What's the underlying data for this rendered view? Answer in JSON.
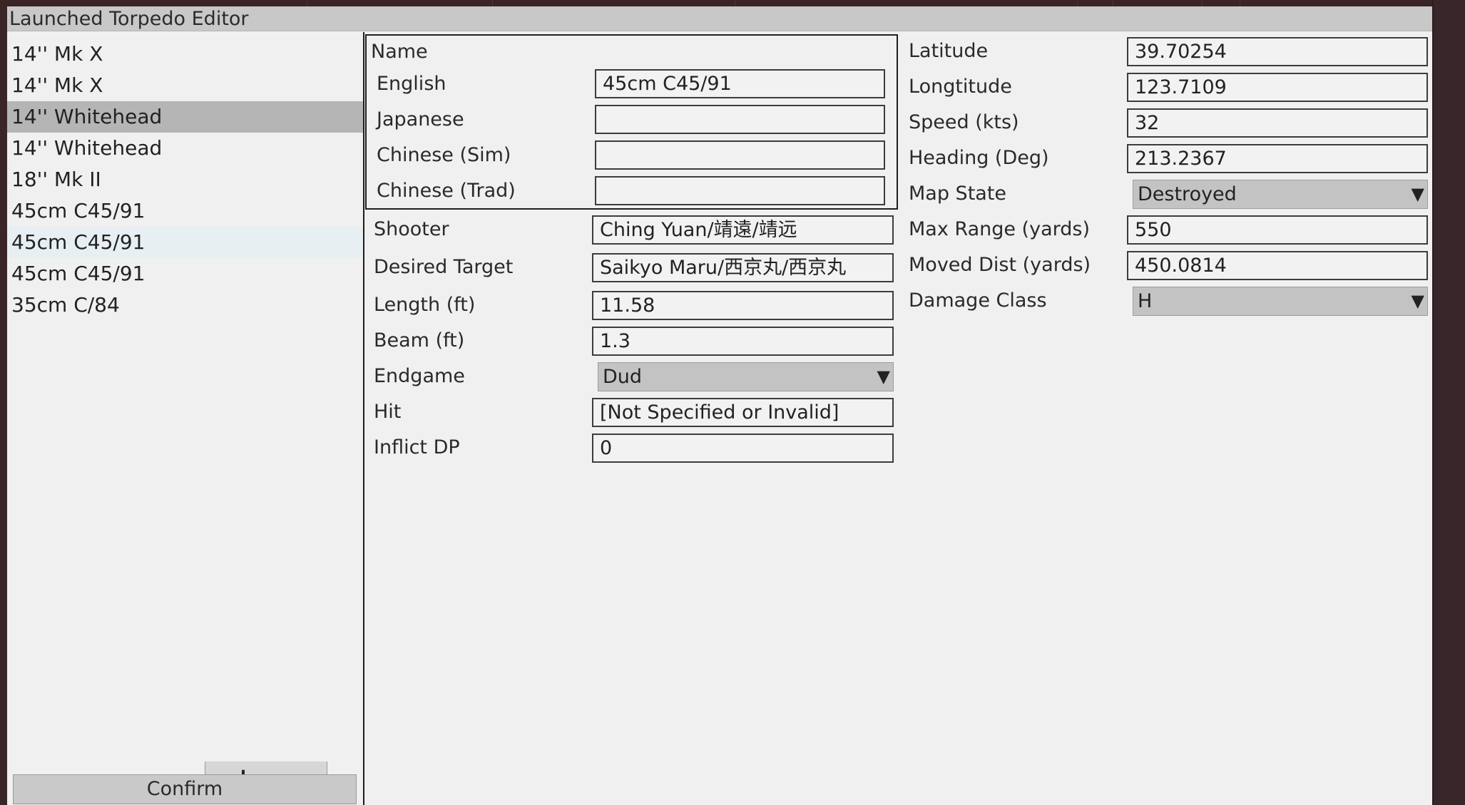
{
  "window": {
    "title": "Launched Torpedo Editor"
  },
  "torpedo_list": {
    "items": [
      {
        "label": "14'' Mk X"
      },
      {
        "label": "14'' Mk X"
      },
      {
        "label": "14'' Whitehead"
      },
      {
        "label": "14'' Whitehead"
      },
      {
        "label": "18'' Mk II"
      },
      {
        "label": "45cm C45/91"
      },
      {
        "label": "45cm C45/91"
      },
      {
        "label": "45cm C45/91"
      },
      {
        "label": "35cm C/84"
      }
    ],
    "selected_index": 2,
    "add_label": "+",
    "remove_label": "-",
    "confirm_label": "Confirm"
  },
  "name_group": {
    "header": "Name",
    "english_label": "English",
    "english_value": "45cm C45/91",
    "japanese_label": "Japanese",
    "japanese_value": "",
    "chinese_sim_label": "Chinese (Sim)",
    "chinese_sim_value": "",
    "chinese_trad_label": "Chinese (Trad)",
    "chinese_trad_value": ""
  },
  "details": {
    "shooter_label": "Shooter",
    "shooter_value": "Ching Yuan/靖遠/靖远",
    "target_label": "Desired Target",
    "target_value": "Saikyo Maru/西京丸/西京丸",
    "length_label": "Length (ft)",
    "length_value": "11.58",
    "beam_label": "Beam (ft)",
    "beam_value": "1.3",
    "endgame_label": "Endgame",
    "endgame_value": "Dud",
    "hit_label": "Hit",
    "hit_value": "[Not Specified or Invalid]",
    "inflict_label": "Inflict DP",
    "inflict_value": "0"
  },
  "state": {
    "latitude_label": "Latitude",
    "latitude_value": "39.70254",
    "longitude_label": "Longtitude",
    "longitude_value": "123.7109",
    "speed_label": "Speed (kts)",
    "speed_value": "32",
    "heading_label": "Heading (Deg)",
    "heading_value": "213.2367",
    "map_state_label": "Map State",
    "map_state_value": "Destroyed",
    "max_range_label": "Max Range (yards)",
    "max_range_value": "550",
    "moved_label": "Moved Dist (yards)",
    "moved_value": "450.0814",
    "damage_class_label": "Damage Class",
    "damage_class_value": "H"
  },
  "icons": {
    "dropdown_arrow": "triangle-down-icon"
  }
}
